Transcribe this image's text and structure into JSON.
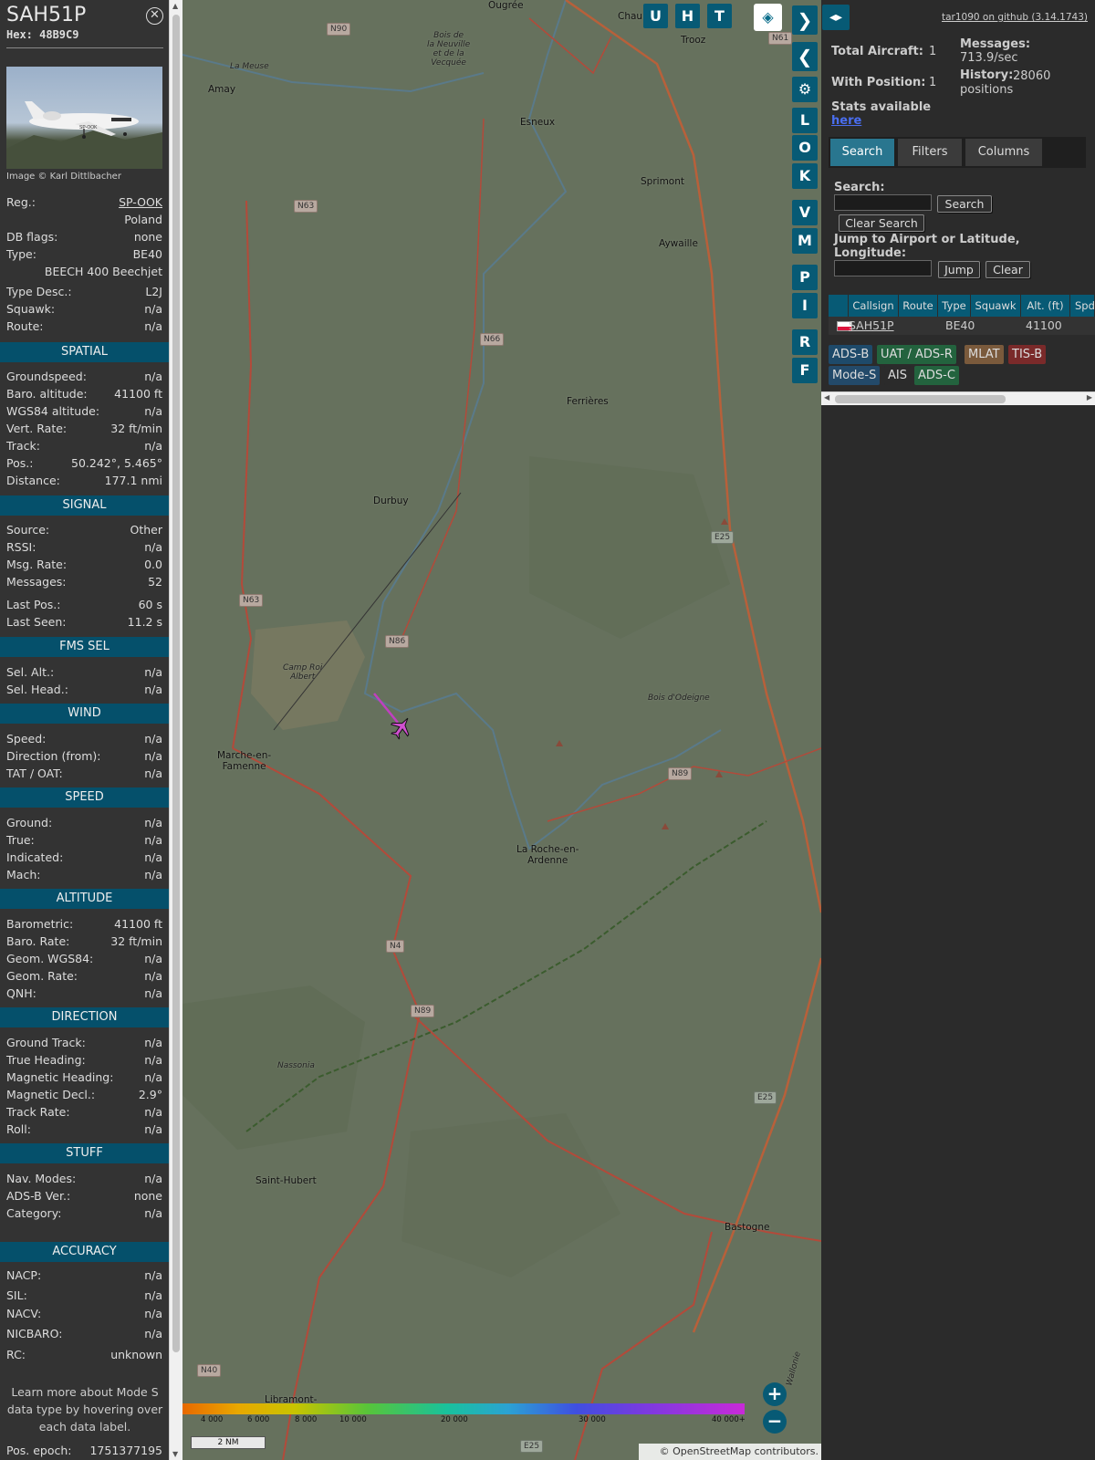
{
  "aircraft": {
    "callsign": "SAH51P",
    "hex_label": "Hex: 48B9C9",
    "photo_credit": "Image © Karl Dittlbacher",
    "photo_reg_text": "SP-OOK"
  },
  "info": [
    {
      "k": "Reg.:",
      "v": "SP-OOK"
    },
    {
      "k": "",
      "v": "Poland"
    },
    {
      "k": "DB flags:",
      "v": "none"
    },
    {
      "k": "Type:",
      "v": "BE40"
    },
    {
      "k": "",
      "v": "BEECH 400 Beechjet"
    },
    {
      "k": "Type Desc.:",
      "v": "L2J"
    },
    {
      "k": "Squawk:",
      "v": "n/a"
    },
    {
      "k": "Route:",
      "v": "n/a"
    }
  ],
  "sections": {
    "spatial": {
      "title": "SPATIAL",
      "rows": [
        {
          "k": "Groundspeed:",
          "v": "n/a"
        },
        {
          "k": "Baro. altitude:",
          "v": "41100 ft"
        },
        {
          "k": "WGS84 altitude:",
          "v": "n/a"
        },
        {
          "k": "Vert. Rate:",
          "v": "32 ft/min"
        },
        {
          "k": "Track:",
          "v": "n/a"
        },
        {
          "k": "Pos.:",
          "v": "50.242°, 5.465°"
        },
        {
          "k": "Distance:",
          "v": "177.1 nmi"
        }
      ]
    },
    "signal": {
      "title": "SIGNAL",
      "rows": [
        {
          "k": "Source:",
          "v": "Other"
        },
        {
          "k": "RSSI:",
          "v": "n/a"
        },
        {
          "k": "Msg. Rate:",
          "v": "0.0"
        },
        {
          "k": "Messages:",
          "v": "52"
        },
        {
          "k": "Last Pos.:",
          "v": "60 s"
        },
        {
          "k": "Last Seen:",
          "v": "11.2 s"
        }
      ]
    },
    "fms": {
      "title": "FMS SEL",
      "rows": [
        {
          "k": "Sel. Alt.:",
          "v": "n/a"
        },
        {
          "k": "Sel. Head.:",
          "v": "n/a"
        }
      ]
    },
    "wind": {
      "title": "WIND",
      "rows": [
        {
          "k": "Speed:",
          "v": "n/a"
        },
        {
          "k": "Direction (from):",
          "v": "n/a"
        },
        {
          "k": "TAT / OAT:",
          "v": "n/a"
        }
      ]
    },
    "speed": {
      "title": "SPEED",
      "rows": [
        {
          "k": "Ground:",
          "v": "n/a"
        },
        {
          "k": "True:",
          "v": "n/a"
        },
        {
          "k": "Indicated:",
          "v": "n/a"
        },
        {
          "k": "Mach:",
          "v": "n/a"
        }
      ]
    },
    "altitude": {
      "title": "ALTITUDE",
      "rows": [
        {
          "k": "Barometric:",
          "v": "41100 ft"
        },
        {
          "k": "Baro. Rate:",
          "v": "32 ft/min"
        },
        {
          "k": "Geom. WGS84:",
          "v": "n/a"
        },
        {
          "k": "Geom. Rate:",
          "v": "n/a"
        },
        {
          "k": "QNH:",
          "v": "n/a"
        }
      ]
    },
    "direction": {
      "title": "DIRECTION",
      "rows": [
        {
          "k": "Ground Track:",
          "v": "n/a"
        },
        {
          "k": "True Heading:",
          "v": "n/a"
        },
        {
          "k": "Magnetic Heading:",
          "v": "n/a"
        },
        {
          "k": "Magnetic Decl.:",
          "v": "2.9°"
        },
        {
          "k": "Track Rate:",
          "v": "n/a"
        },
        {
          "k": "Roll:",
          "v": "n/a"
        }
      ]
    },
    "stuff": {
      "title": "STUFF",
      "rows": [
        {
          "k": "Nav. Modes:",
          "v": "n/a"
        },
        {
          "k": "ADS-B Ver.:",
          "v": "none"
        },
        {
          "k": "Category:",
          "v": "n/a"
        }
      ]
    },
    "accuracy": {
      "title": "ACCURACY",
      "rows": [
        {
          "k": "NACP:",
          "v": "n/a"
        },
        {
          "k": "SIL:",
          "v": "n/a"
        },
        {
          "k": "NACV:",
          "v": "n/a"
        },
        {
          "k": "NICBARO:",
          "v": "n/a"
        },
        {
          "k": "RC:",
          "v": "unknown"
        }
      ]
    }
  },
  "footnote": "Learn more about Mode S data type by hovering over each data label.",
  "pos_epoch": {
    "k": "Pos. epoch:",
    "v": "1751377195"
  },
  "map": {
    "toolbar": [
      "U",
      "H",
      "T"
    ],
    "side_buttons": [
      "L",
      "O",
      "K",
      "V",
      "M",
      "P",
      "I",
      "R",
      "F"
    ],
    "places": {
      "ougree": "Ougrée",
      "chaudfontaine": "Chau",
      "trooz": "Trooz",
      "amay": "Amay",
      "esneux": "Esneux",
      "sprimont": "Sprimont",
      "aywaille": "Aywaille",
      "ferrieres": "Ferrières",
      "durbuy": "Durbuy",
      "marche": "Marche-en-\nFamenne",
      "laroche": "La Roche-en-\nArdenne",
      "sainthubert": "Saint-Hubert",
      "bastogne": "Bastogne",
      "libramont": "Libramont-",
      "bois_neuville": "Bois de\nla Neuville\net de la\nVecquée",
      "lameuse": "La Meuse",
      "camp_roi": "Camp Roi\nAlbert",
      "bois_odeigne": "Bois d'Odeigne",
      "nassonia": "Nassonia",
      "wallonie": "Wallonie"
    },
    "roads": {
      "n90": "N90",
      "n63a": "N63",
      "n63b": "N63",
      "n66": "N66",
      "n86": "N86",
      "n89a": "N89",
      "n89b": "N89",
      "n4": "N4",
      "n40": "N40",
      "n61": "N61",
      "e25a": "E25",
      "e25b": "E25",
      "e25c": "E25"
    },
    "altitude_scale": [
      "4 000",
      "6 000",
      "8 000",
      "10 000",
      "20 000",
      "30 000",
      "40 000+"
    ],
    "scale_label": "2 NM",
    "attribution": "© OpenStreetMap contributors."
  },
  "right": {
    "github": "tar1090 on github (3.14.1743)",
    "total_aircraft": {
      "k": "Total Aircraft:",
      "v": "1"
    },
    "with_position": {
      "k": "With Position:",
      "v": "1"
    },
    "messages": {
      "k": "Messages:",
      "v": "713.9/sec"
    },
    "history": {
      "k": "History:",
      "v": "28060 positions"
    },
    "stats_text": "Stats available",
    "stats_link": "here",
    "tabs": [
      "Search",
      "Filters",
      "Columns"
    ],
    "search_label": "Search:",
    "search_button": "Search",
    "clear_search_button": "Clear Search",
    "jump_label": "Jump to Airport or Latitude, Longitude:",
    "jump_button": "Jump",
    "clear_button": "Clear",
    "table": {
      "headers": [
        "",
        "Callsign",
        "Route",
        "Type",
        "Squawk",
        "Alt. (ft)",
        "Spd."
      ],
      "row": {
        "callsign": "SAH51P",
        "route": "",
        "type": "BE40",
        "squawk": "",
        "alt": "41100",
        "spd": ""
      }
    },
    "legend": [
      {
        "label": "ADS-B",
        "color": "#1e4a6a"
      },
      {
        "label": "UAT / ADS-R",
        "color": "#23633e"
      },
      {
        "label": "MLAT",
        "color": "#7a5a3c"
      },
      {
        "label": "TIS-B",
        "color": "#7a2a2a"
      },
      {
        "label": "Mode-S",
        "color": "#234a6a"
      },
      {
        "label": "AIS",
        "color": "#2b2b2b"
      },
      {
        "label": "ADS-C",
        "color": "#23633e"
      }
    ]
  }
}
